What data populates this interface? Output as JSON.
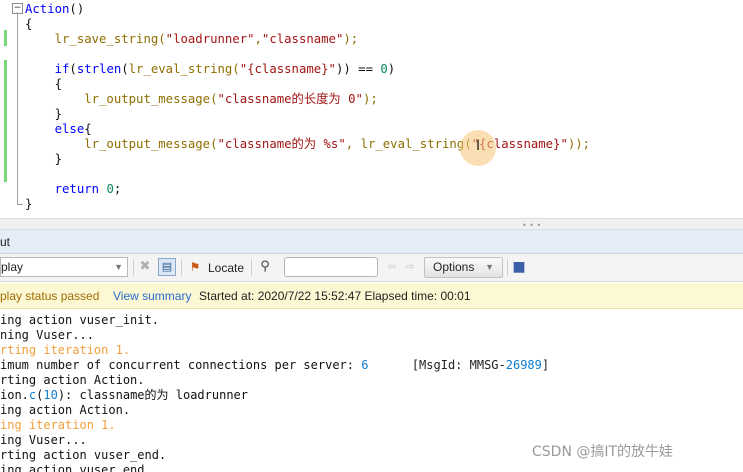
{
  "editor": {
    "lines": [
      [
        {
          "t": "Action",
          "c": "kw"
        },
        {
          "t": "()",
          "c": "plain"
        }
      ],
      [
        {
          "t": "{",
          "c": "plain"
        }
      ],
      [
        {
          "t": "    lr_save_string(",
          "c": "fn"
        },
        {
          "t": "\"loadrunner\"",
          "c": "str"
        },
        {
          "t": ",",
          "c": "fn"
        },
        {
          "t": "\"classname\"",
          "c": "str"
        },
        {
          "t": ");",
          "c": "fn"
        }
      ],
      [
        {
          "t": "",
          "c": "plain"
        }
      ],
      [
        {
          "t": "    if",
          "c": "kw"
        },
        {
          "t": "(",
          "c": "plain"
        },
        {
          "t": "strlen",
          "c": "kw"
        },
        {
          "t": "(",
          "c": "plain"
        },
        {
          "t": "lr_eval_string(",
          "c": "fn"
        },
        {
          "t": "\"{classname}\"",
          "c": "str"
        },
        {
          "t": ")) == ",
          "c": "plain"
        },
        {
          "t": "0",
          "c": "num"
        },
        {
          "t": ")",
          "c": "plain"
        }
      ],
      [
        {
          "t": "    {",
          "c": "plain"
        }
      ],
      [
        {
          "t": "        lr_output_message(",
          "c": "fn"
        },
        {
          "t": "\"classname的长度为 0\"",
          "c": "str"
        },
        {
          "t": ");",
          "c": "fn"
        }
      ],
      [
        {
          "t": "    }",
          "c": "plain"
        }
      ],
      [
        {
          "t": "    else",
          "c": "kw"
        },
        {
          "t": "{",
          "c": "plain"
        }
      ],
      [
        {
          "t": "        lr_output_message(",
          "c": "fn"
        },
        {
          "t": "\"classname的为 %s\"",
          "c": "str"
        },
        {
          "t": ", ",
          "c": "fn"
        },
        {
          "t": "lr_eval_string(",
          "c": "fn"
        },
        {
          "t": "\"{classname}\"",
          "c": "str"
        },
        {
          "t": "));",
          "c": "fn"
        }
      ],
      [
        {
          "t": "    }",
          "c": "plain"
        }
      ],
      [
        {
          "t": "",
          "c": "plain"
        }
      ],
      [
        {
          "t": "    return ",
          "c": "kw"
        },
        {
          "t": "0",
          "c": "num"
        },
        {
          "t": ";",
          "c": "plain"
        }
      ],
      [
        {
          "t": "}",
          "c": "plain"
        }
      ]
    ]
  },
  "panel": {
    "title": "ut",
    "toolbar": {
      "filter_value": "play",
      "locate_label": "Locate",
      "search_value": "",
      "options_label": "Options"
    },
    "status": {
      "result": "play status passed",
      "view_summary": "View summary",
      "info": "Started at: 2020/7/22 15:52:47 Elapsed time: 00:01"
    },
    "log_lines": [
      [
        {
          "t": "ing action vuser_init.",
          "c": "c-black"
        }
      ],
      [
        {
          "t": "ning Vuser...",
          "c": "c-black"
        }
      ],
      [
        {
          "t": "rting iteration 1.",
          "c": "c-orange"
        }
      ],
      [
        {
          "t": "imum number of concurrent connections per server: ",
          "c": "c-black"
        },
        {
          "t": "6",
          "c": "c-blue"
        },
        {
          "t": "      [MsgId: MMSG-",
          "c": "c-dark"
        },
        {
          "t": "26989",
          "c": "c-blue"
        },
        {
          "t": "]",
          "c": "c-dark"
        }
      ],
      [
        {
          "t": "rting action Action.",
          "c": "c-black"
        }
      ],
      [
        {
          "t": "ion.",
          "c": "c-black"
        },
        {
          "t": "c",
          "c": "c-blue"
        },
        {
          "t": "(",
          "c": "c-black"
        },
        {
          "t": "10",
          "c": "c-blue"
        },
        {
          "t": "): classname的为 loadrunner",
          "c": "c-black"
        }
      ],
      [
        {
          "t": "ing action Action.",
          "c": "c-black"
        }
      ],
      [
        {
          "t": "ing iteration 1.",
          "c": "c-orange"
        }
      ],
      [
        {
          "t": "ing Vuser...",
          "c": "c-black"
        }
      ],
      [
        {
          "t": "rting action vuser_end.",
          "c": "c-black"
        }
      ],
      [
        {
          "t": "ing action vuser_end.",
          "c": "c-black"
        }
      ]
    ]
  },
  "watermark": "CSDN @搞IT的放牛娃",
  "colors": {
    "status_bg": "#fbf8d3",
    "status_passed": "#a06c06",
    "link": "#2a6bd2",
    "log_orange": "#f2a03c",
    "log_blue": "#0f7fd0",
    "change_bar": "#78d778"
  },
  "icons": [
    "fold-minus-icon",
    "clear-icon",
    "filter-icon",
    "locate-flag-icon",
    "search-icon",
    "prev-icon",
    "next-icon",
    "save-icon"
  ]
}
